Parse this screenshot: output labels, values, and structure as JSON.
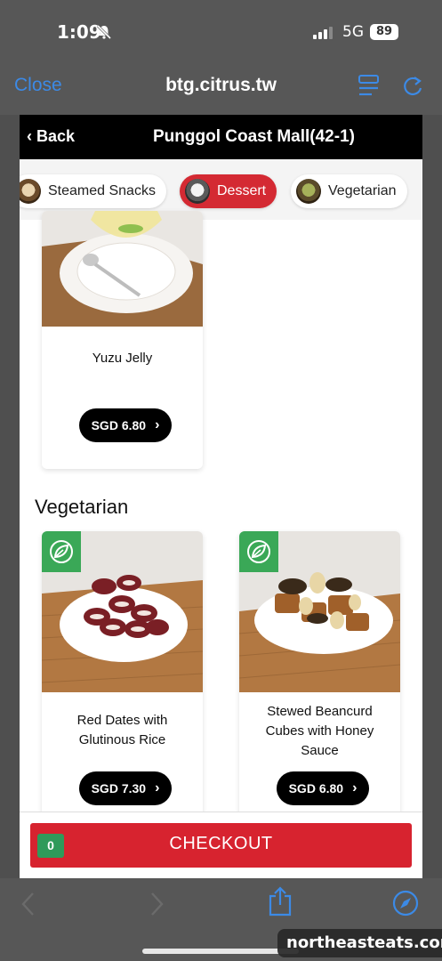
{
  "status": {
    "time": "1:09",
    "network": "5G",
    "battery": "89"
  },
  "browser": {
    "close_label": "Close",
    "url": "btg.citrus.tw"
  },
  "header": {
    "back_label": "Back",
    "store_name": "Punggol Coast Mall(42-1)"
  },
  "categories": [
    {
      "label": "Steamed Snacks",
      "active": false
    },
    {
      "label": "Dessert",
      "active": true
    },
    {
      "label": "Vegetarian",
      "active": false
    }
  ],
  "dessert_items": [
    {
      "name": "Yuzu Jelly",
      "price": "SGD 6.80"
    }
  ],
  "vegetarian": {
    "title": "Vegetarian",
    "items": [
      {
        "name": "Red Dates with Glutinous Rice",
        "price": "SGD 7.30"
      },
      {
        "name": "Stewed Beancurd Cubes with Honey Sauce",
        "price": "SGD 6.80"
      }
    ]
  },
  "checkout": {
    "count": "0",
    "label": "CHECKOUT"
  },
  "watermark": "northeasteats.com",
  "colors": {
    "accent_red": "#d7232f",
    "ios_blue": "#3c8ae6",
    "veg_green": "#3aa857",
    "header_black": "#000000"
  }
}
